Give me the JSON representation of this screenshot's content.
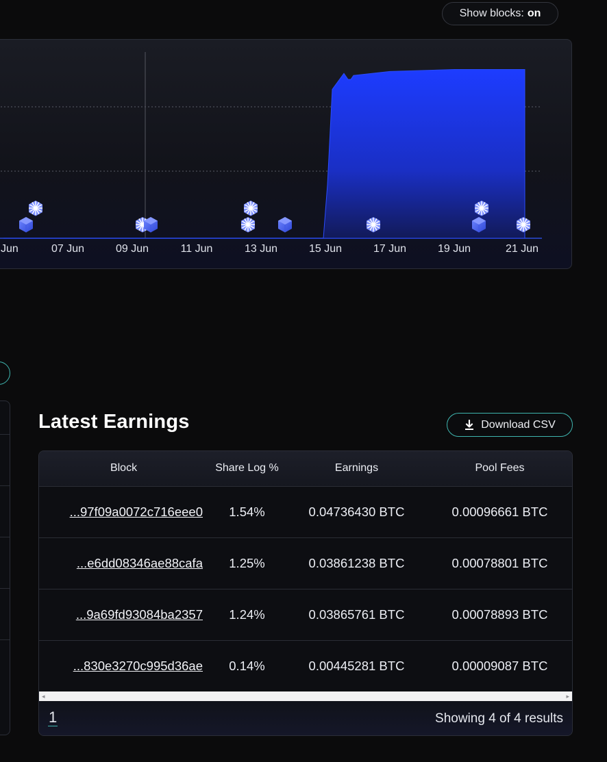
{
  "toggle": {
    "label": "Show blocks:",
    "state": "on"
  },
  "chart": {
    "type": "area",
    "accent_color": "#1f3fff",
    "x_ticks": [
      "Jun",
      "07 Jun",
      "09 Jun",
      "11 Jun",
      "13 Jun",
      "15 Jun",
      "17 Jun",
      "19 Jun",
      "21 Jun"
    ],
    "block_markers": [
      {
        "date": "05 Jun",
        "kind": "found"
      },
      {
        "date": "06 Jun",
        "kind": "found"
      },
      {
        "date": "06 Jun",
        "kind": "cube"
      },
      {
        "date": "09 Jun",
        "kind": "found"
      },
      {
        "date": "10 Jun",
        "kind": "cube"
      },
      {
        "date": "13 Jun",
        "kind": "found"
      },
      {
        "date": "13 Jun",
        "kind": "found"
      },
      {
        "date": "14 Jun",
        "kind": "cube"
      },
      {
        "date": "16 Jun",
        "kind": "found"
      },
      {
        "date": "20 Jun",
        "kind": "found"
      },
      {
        "date": "20 Jun",
        "kind": "cube"
      },
      {
        "date": "21 Jun",
        "kind": "found"
      }
    ]
  },
  "chart_data": {
    "type": "area",
    "x": [
      "05 Jun",
      "07 Jun",
      "09 Jun",
      "11 Jun",
      "13 Jun",
      "15 Jun",
      "15 Jun",
      "15 Jun",
      "16 Jun",
      "16 Jun",
      "16 Jun",
      "17 Jun",
      "19 Jun",
      "21 Jun"
    ],
    "values": [
      0,
      0,
      0,
      0,
      0,
      0,
      0.27,
      0.75,
      0.83,
      0.8,
      0.82,
      0.84,
      0.85,
      0.85
    ],
    "ylim": [
      0,
      1
    ],
    "grid": true
  },
  "earnings": {
    "title": "Latest Earnings",
    "download_label": "Download CSV",
    "columns": [
      "Block",
      "Share Log %",
      "Earnings",
      "Pool Fees"
    ],
    "rows": [
      {
        "block": "...97f09a0072c716eee0",
        "share": "1.54%",
        "earnings": "0.04736430 BTC",
        "fees": "0.00096661 BTC"
      },
      {
        "block": "...e6dd08346ae88cafa",
        "share": "1.25%",
        "earnings": "0.03861238 BTC",
        "fees": "0.00078801 BTC"
      },
      {
        "block": "...9a69fd93084ba2357",
        "share": "1.24%",
        "earnings": "0.03865761 BTC",
        "fees": "0.00078893 BTC"
      },
      {
        "block": "...830e3270c995d36ae",
        "share": "0.14%",
        "earnings": "0.00445281 BTC",
        "fees": "0.00009087 BTC"
      }
    ],
    "page": "1",
    "results_text": "Showing 4 of 4 results"
  }
}
